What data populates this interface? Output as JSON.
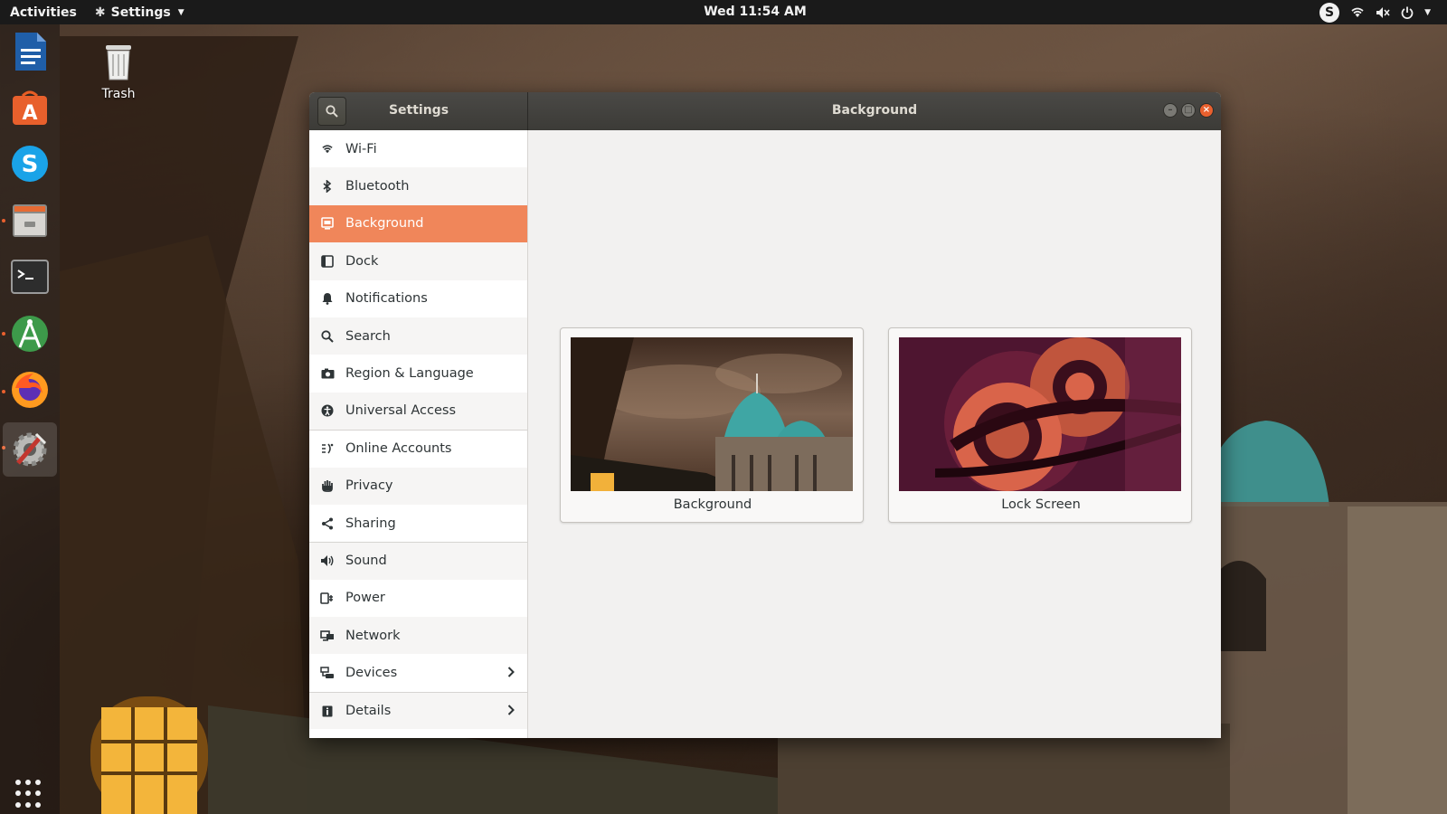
{
  "topbar": {
    "activities": "Activities",
    "app_menu": "Settings",
    "clock": "Wed 11:54 AM",
    "tray_icons": [
      "skype-icon",
      "wifi-icon",
      "volume-muted-icon",
      "power-icon",
      "caret-down-icon"
    ]
  },
  "desktop": {
    "trash_label": "Trash"
  },
  "dock": {
    "items": [
      "libreoffice-writer-icon",
      "ubuntu-software-icon",
      "skype-icon",
      "files-icon",
      "terminal-icon",
      "android-studio-icon",
      "firefox-icon",
      "settings-icon"
    ],
    "show_apps": "show-applications-icon"
  },
  "window": {
    "sidebar_title": "Settings",
    "title": "Background",
    "accent_color": "#f0865a",
    "close_color": "#e9602e"
  },
  "sidebar": {
    "items": [
      {
        "label": "Wi-Fi",
        "icon": "wifi-icon"
      },
      {
        "label": "Bluetooth",
        "icon": "bluetooth-icon"
      },
      {
        "label": "Background",
        "icon": "background-icon"
      },
      {
        "label": "Dock",
        "icon": "dock-icon"
      },
      {
        "label": "Notifications",
        "icon": "bell-icon"
      },
      {
        "label": "Search",
        "icon": "search-icon"
      },
      {
        "label": "Region & Language",
        "icon": "camera-icon"
      },
      {
        "label": "Universal Access",
        "icon": "accessibility-icon"
      },
      {
        "label": "Online Accounts",
        "icon": "online-accounts-icon"
      },
      {
        "label": "Privacy",
        "icon": "hand-icon"
      },
      {
        "label": "Sharing",
        "icon": "share-icon"
      },
      {
        "label": "Sound",
        "icon": "speaker-icon"
      },
      {
        "label": "Power",
        "icon": "power-plug-icon"
      },
      {
        "label": "Network",
        "icon": "network-icon"
      },
      {
        "label": "Devices",
        "icon": "devices-icon"
      },
      {
        "label": "Details",
        "icon": "info-icon"
      }
    ],
    "selected": "Background"
  },
  "content": {
    "cards": [
      {
        "label": "Background"
      },
      {
        "label": "Lock Screen"
      }
    ]
  }
}
